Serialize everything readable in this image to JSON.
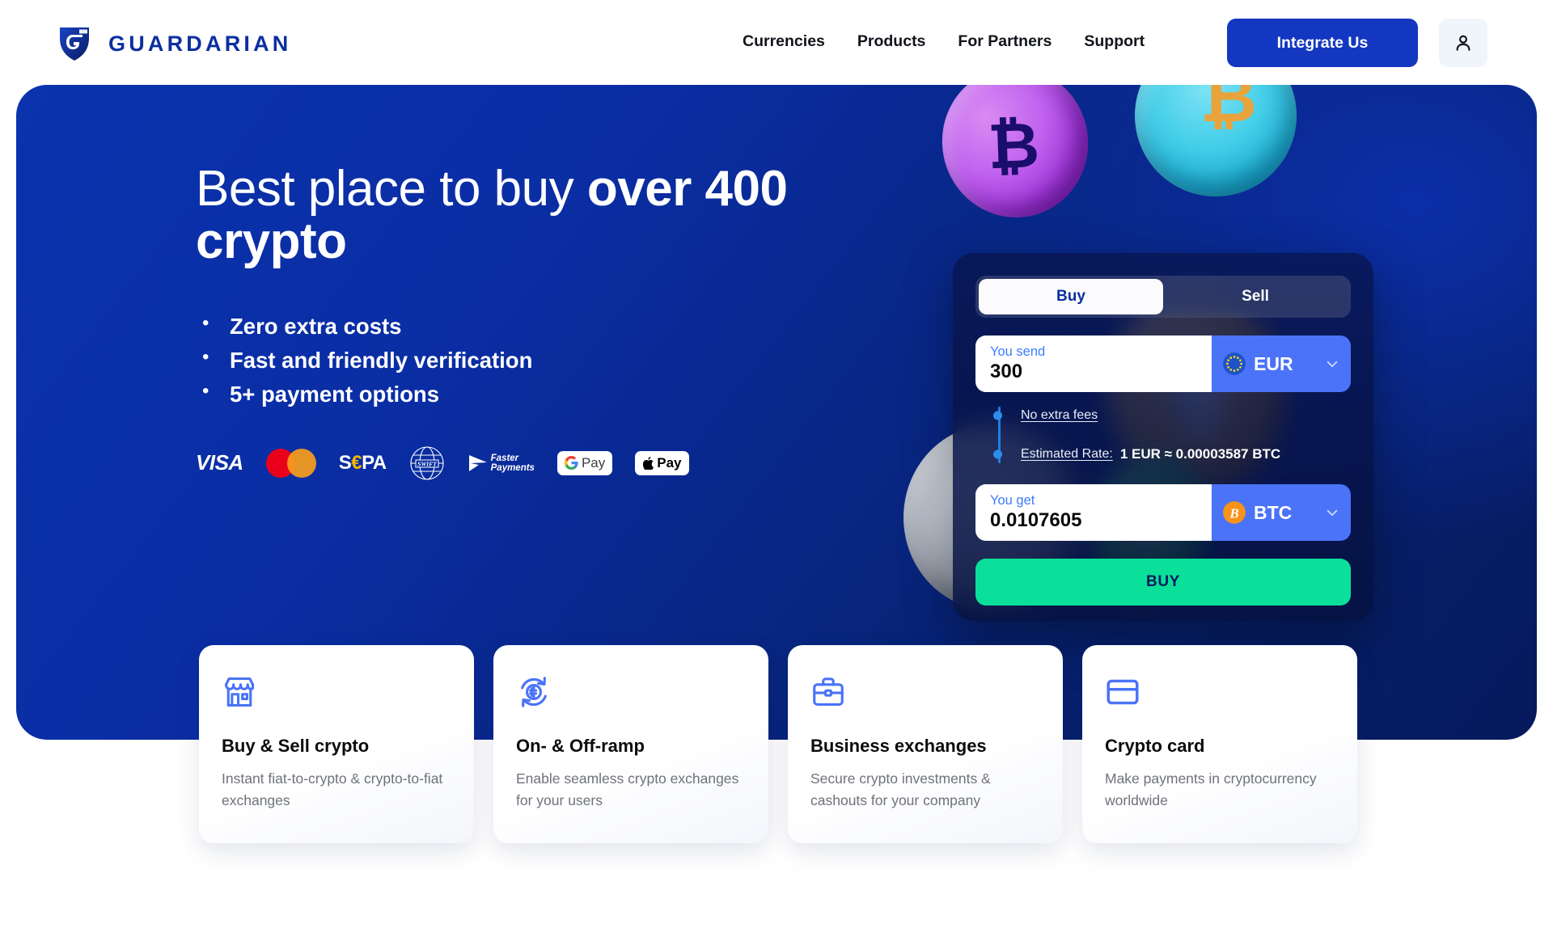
{
  "brand": {
    "name": "GUARDARIAN",
    "logo_icon": "shield-g-logo-icon",
    "color": "#0b2f9e"
  },
  "header": {
    "nav": [
      {
        "label": "Currencies",
        "name": "nav-currencies"
      },
      {
        "label": "Products",
        "name": "nav-products"
      },
      {
        "label": "For Partners",
        "name": "nav-for-partners"
      },
      {
        "label": "Support",
        "name": "nav-support"
      }
    ],
    "cta_label": "Integrate Us",
    "cta_color": "#1337c0",
    "account_icon": "user-account-icon"
  },
  "hero": {
    "title_plain": "Best place to buy ",
    "title_bold": "over 400 crypto",
    "bullets": [
      "Zero extra costs",
      "Fast and friendly verification",
      "5+ payment options"
    ],
    "payment_logos": [
      {
        "name": "visa-logo",
        "label": "VISA"
      },
      {
        "name": "mastercard-logo",
        "label": "Mastercard"
      },
      {
        "name": "sepa-logo",
        "label_a": "S",
        "label_b": "€",
        "label_c": "PA"
      },
      {
        "name": "swift-logo",
        "label": "SWIFT"
      },
      {
        "name": "faster-payments-logo",
        "label_a": "Faster",
        "label_b": "Payments"
      },
      {
        "name": "google-pay-logo",
        "label": "Pay"
      },
      {
        "name": "apple-pay-logo",
        "label": "Pay"
      }
    ],
    "background_color": "#0a2ea0",
    "coins": [
      {
        "name": "coin-purple-bitcoin",
        "symbol": "₿"
      },
      {
        "name": "coin-cyan-bitcoin",
        "symbol": "₿"
      },
      {
        "name": "coin-gold-ethereum",
        "symbol": "◆"
      },
      {
        "name": "coin-silver-blank",
        "symbol": ""
      },
      {
        "name": "coin-green-stellar",
        "symbol": "⊖"
      }
    ]
  },
  "widget": {
    "tabs": [
      {
        "label": "Buy",
        "active": true
      },
      {
        "label": "Sell",
        "active": false
      }
    ],
    "send": {
      "label": "You send",
      "value": "300",
      "currency_code": "EUR",
      "currency_icon": "eur-flag-icon"
    },
    "get": {
      "label": "You get",
      "value": "0.0107605",
      "currency_code": "BTC",
      "currency_icon": "btc-coin-icon"
    },
    "fees_label": "No extra fees",
    "rate_label": "Estimated Rate:",
    "rate_value": "1 EUR ≈ 0.00003587 BTC",
    "submit_label": "BUY",
    "submit_color": "#0ae099",
    "accent_color": "#4a73f8"
  },
  "cards": [
    {
      "icon": "storefront-icon",
      "title": "Buy & Sell crypto",
      "desc": "Instant fiat-to-crypto & crypto-to-fiat exchanges"
    },
    {
      "icon": "crypto-swap-icon",
      "title": "On- & Off-ramp",
      "desc": "Enable seamless crypto exchanges for your users"
    },
    {
      "icon": "briefcase-icon",
      "title": "Business exchanges",
      "desc": "Secure crypto investments & cashouts for your company"
    },
    {
      "icon": "credit-card-icon",
      "title": "Crypto card",
      "desc": "Make payments in cryptocurrency worldwide"
    }
  ]
}
